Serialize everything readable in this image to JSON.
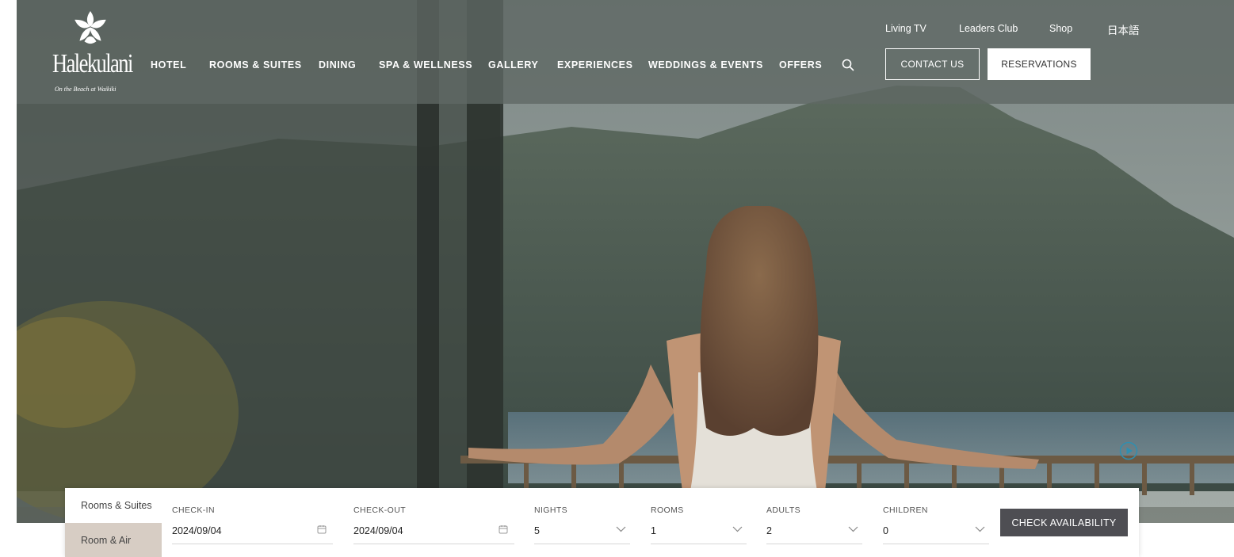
{
  "brand": {
    "name": "Halekulani",
    "tagline": "On the Beach at Waikiki"
  },
  "utility_nav": {
    "items": [
      "Living TV",
      "Leaders Club",
      "Shop",
      "日本語"
    ]
  },
  "main_nav": {
    "items": [
      "HOTEL",
      "ROOMS & SUITES",
      "DINING",
      "SPA & WELLNESS",
      "GALLERY",
      "EXPERIENCES",
      "WEDDINGS & EVENTS",
      "OFFERS"
    ]
  },
  "header_buttons": {
    "contact": "CONTACT US",
    "reservations": "RESERVATIONS"
  },
  "booking": {
    "tabs": [
      "Rooms & Suites",
      "Room & Air"
    ],
    "checkin": {
      "label": "CHECK-IN",
      "value": "2024/09/04"
    },
    "checkout": {
      "label": "CHECK-OUT",
      "value": "2024/09/04"
    },
    "nights": {
      "label": "NIGHTS",
      "value": "5"
    },
    "rooms": {
      "label": "ROOMS",
      "value": "1"
    },
    "adults": {
      "label": "ADULTS",
      "value": "2"
    },
    "children": {
      "label": "CHILDREN",
      "value": "0"
    },
    "submit": "CHECK AVAILABILITY"
  },
  "icons": {
    "search": "search-icon",
    "play": "play-icon",
    "calendar": "calendar-icon",
    "chevron": "chevron-down-icon",
    "logo": "orchid-logo-icon"
  },
  "colors": {
    "nav_overlay": "#5f6864",
    "tab_inactive": "#d7cdc4",
    "cta_dark": "#4e4e53",
    "play_accent": "#2f8fb0"
  }
}
